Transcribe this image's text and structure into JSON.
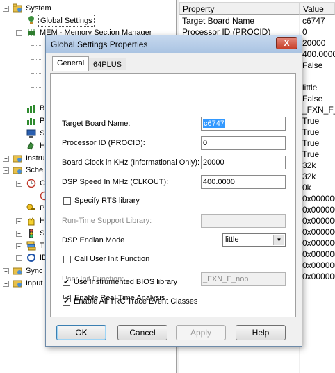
{
  "tree": {
    "items": [
      {
        "label": "System"
      },
      {
        "label": "Global Settings"
      },
      {
        "label": "MEM - Memory Section Manager"
      },
      {
        "label": "B"
      },
      {
        "label": "P"
      },
      {
        "label": "S"
      },
      {
        "label": "H"
      },
      {
        "label": "Instru"
      },
      {
        "label": "Sche"
      },
      {
        "label": "C"
      },
      {
        "label": "P"
      },
      {
        "label": "H"
      },
      {
        "label": "S"
      },
      {
        "label": "T"
      },
      {
        "label": "ID"
      },
      {
        "label": "Sync"
      },
      {
        "label": "Input"
      }
    ]
  },
  "properties": {
    "header_property": "Property",
    "header_value": "Value",
    "rows": [
      {
        "name": "Target Board Name",
        "value": "c6747"
      },
      {
        "name": "Processor ID (PROCID)",
        "value": "0"
      },
      {
        "name": "",
        "value": "20000"
      },
      {
        "name": "",
        "value": "400.0000"
      },
      {
        "name": "",
        "value": "False"
      },
      {
        "name": "",
        "value": ""
      },
      {
        "name": "",
        "value": "little"
      },
      {
        "name": "",
        "value": "False"
      },
      {
        "name": "",
        "value": "_FXN_F_n"
      },
      {
        "name": "",
        "value": "True"
      },
      {
        "name": "",
        "value": "True"
      },
      {
        "name": "",
        "value": "True"
      },
      {
        "name": "",
        "value": "True"
      },
      {
        "name": "",
        "value": "32k"
      },
      {
        "name": "",
        "value": "32k"
      },
      {
        "name": "",
        "value": "0k"
      },
      {
        "name": "",
        "value": "0x000000"
      },
      {
        "name": "",
        "value": "0x000000"
      },
      {
        "name": "",
        "value": "0x000000"
      },
      {
        "name": "",
        "value": "0x000000"
      },
      {
        "name": "",
        "value": "0x000000"
      },
      {
        "name": "",
        "value": "0x000000"
      },
      {
        "name": "",
        "value": "0x000000"
      },
      {
        "name": "",
        "value": "0x000000"
      }
    ]
  },
  "dialog": {
    "title": "Global Settings Properties",
    "close_label": "X",
    "tabs": [
      {
        "label": "General"
      },
      {
        "label": "64PLUS"
      }
    ],
    "fields": {
      "target_board_label": "Target Board Name:",
      "target_board_value": "c6747",
      "processor_id_label": "Processor ID (PROCID):",
      "processor_id_value": "0",
      "board_clock_label": "Board Clock in KHz (Informational Only):",
      "board_clock_value": "20000",
      "dsp_speed_label": "DSP Speed In MHz (CLKOUT):",
      "dsp_speed_value": "400.0000",
      "specify_rts_label": "Specify RTS library",
      "specify_rts_checked": false,
      "rts_library_label": "Run-Time Support Library:",
      "rts_library_value": "",
      "endian_label": "DSP Endian Mode",
      "endian_value": "little",
      "call_user_init_label": "Call User Init Function",
      "call_user_init_checked": false,
      "user_init_label": "User Init Function:",
      "user_init_value": "_FXN_F_nop",
      "enable_rta_label": "Enable Real Time Analysis",
      "enable_rta_checked": true,
      "instrumented_bios_label": "Use Instrumented BIOS library",
      "instrumented_bios_checked": true,
      "enable_trc_label": "Enable All TRC Trace Event Classes",
      "enable_trc_checked": true
    },
    "buttons": {
      "ok": "OK",
      "cancel": "Cancel",
      "apply": "Apply",
      "help": "Help"
    }
  },
  "colors": {
    "selection": "#3399ff",
    "title_bar": "#b9cfea",
    "close_button": "#c7402a"
  }
}
